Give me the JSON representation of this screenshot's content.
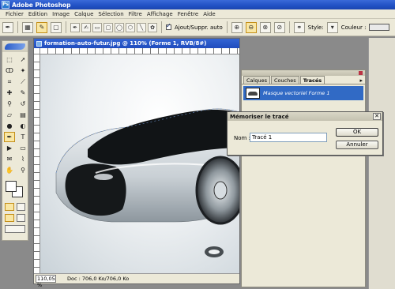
{
  "app": {
    "title": "Adobe Photoshop"
  },
  "menu": {
    "items": [
      "Fichier",
      "Edition",
      "Image",
      "Calque",
      "Sélection",
      "Filtre",
      "Affichage",
      "Fenêtre",
      "Aide"
    ]
  },
  "options": {
    "autoadd_label": "Ajout/Suppr. auto",
    "style_label": "Style:",
    "color_label": "Couleur :",
    "color_value": "#e9e9e9"
  },
  "document": {
    "title": "formation-auto-futur.jpg @ 110% (Forme 1, RVB/8#)",
    "zoom": "110,05 %",
    "doc_info": "Doc : 706,0 Ko/706,0 Ko"
  },
  "paths_panel": {
    "tabs": [
      "Calques",
      "Couches",
      "Tracés"
    ],
    "active_tab": 2,
    "path_name": "Masque vectoriel Forme 1",
    "selection_color": "#316ac5"
  },
  "dialog": {
    "title": "Mémoriser le tracé",
    "name_label": "Nom :",
    "name_value": "Tracé 1",
    "ok_label": "OK",
    "cancel_label": "Annuler"
  }
}
